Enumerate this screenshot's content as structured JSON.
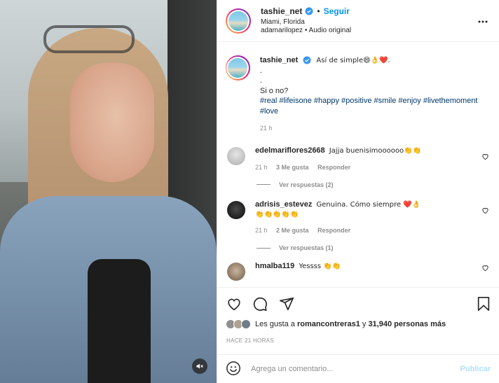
{
  "header": {
    "username": "tashie_net",
    "follow_label": "Seguir",
    "separator": "•",
    "location": "Miami, Florida",
    "audio": "adamarilopez • Audio original"
  },
  "caption": {
    "username": "tashie_net",
    "line1": "Así de simple😄👌❤️.",
    "line2": ".",
    "line3": ".",
    "line4": "Si o no?",
    "hashtags": "#real #lifeisone #happy #positive #smile #enjoy #livethemoment #love",
    "time": "21 h"
  },
  "comments": [
    {
      "username": "edelmariflores2668",
      "text": "Jajja buenisimoooooo👏👏",
      "time": "21 h",
      "likes": "3 Me gusta",
      "reply": "Responder",
      "view_replies": "Ver respuestas (2)"
    },
    {
      "username": "adrisis_estevez",
      "text": "Genuina. Cómo siempre ❤️👌",
      "text2": "👏👏👏👏👏",
      "time": "21 h",
      "likes": "2 Me gusta",
      "reply": "Responder",
      "view_replies": "Ver respuestas (1)"
    },
    {
      "username": "hmalba119",
      "text": "Yessss 👏👏"
    }
  ],
  "likes": {
    "prefix": "Les gusta a ",
    "user": "romancontreras1",
    "middle": " y ",
    "count": "31,940 personas más"
  },
  "timeago": "HACE 21 HORAS",
  "composer": {
    "placeholder": "Agrega un comentario...",
    "publish_label": "Publicar"
  },
  "colors": {
    "accent": "#0095f6",
    "hashtag": "#00376b",
    "muted": "#8e8e8e",
    "heart": "#ed4956",
    "publish_disabled": "#b2dffc"
  }
}
